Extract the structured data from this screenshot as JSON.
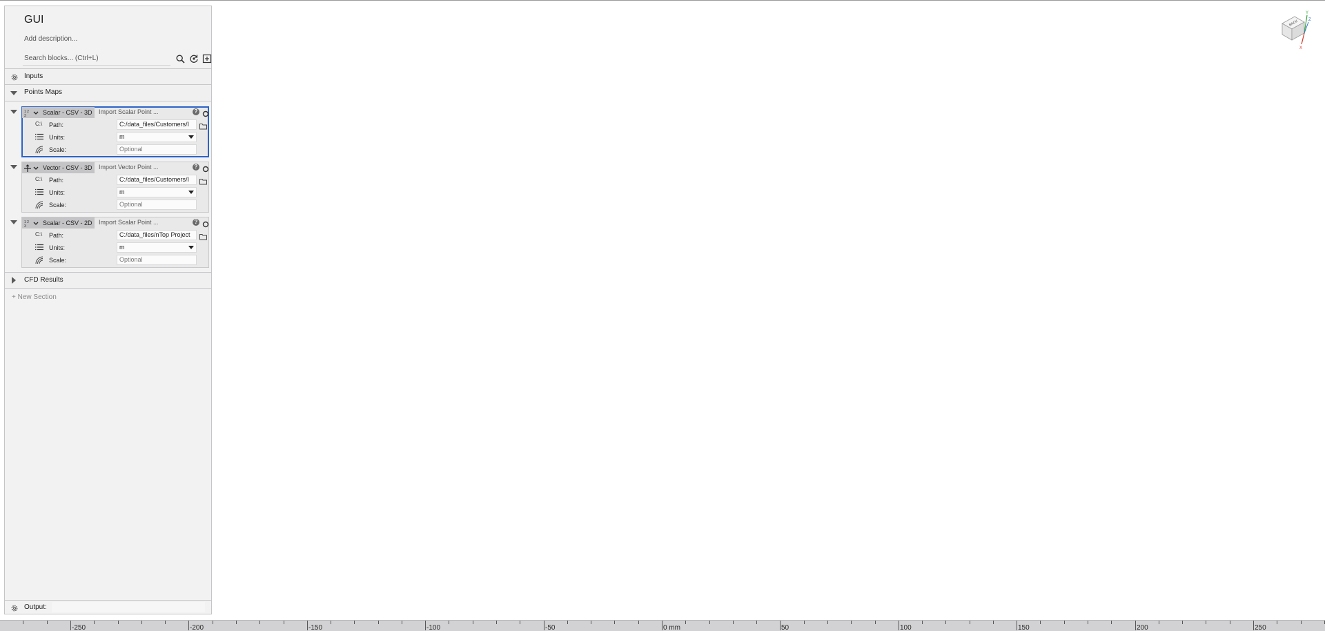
{
  "panel": {
    "title": "GUI",
    "description": "Add description...",
    "search_placeholder": "Search blocks... (Ctrl+L)"
  },
  "sections": {
    "inputs": "Inputs",
    "points_maps": "Points Maps",
    "cfd_results": "CFD Results",
    "new_section": "+ New Section"
  },
  "blocks": [
    {
      "tag": "Scalar - CSV - 3D",
      "name": "Import Scalar Point ...",
      "path_label": "Path:",
      "path_value": "C:/data_files/Customers/I",
      "units_label": "Units:",
      "units_value": "m",
      "scale_label": "Scale:",
      "scale_placeholder": "Optional"
    },
    {
      "tag": "Vector - CSV - 3D",
      "name": "Import Vector Point ...",
      "path_label": "Path:",
      "path_value": "C:/data_files/Customers/I",
      "units_label": "Units:",
      "units_value": "m",
      "scale_label": "Scale:",
      "scale_placeholder": "Optional"
    },
    {
      "tag": "Scalar - CSV - 2D",
      "name": "Import Scalar Point ...",
      "path_label": "Path:",
      "path_value": "C:/data_files/nTop Project",
      "units_label": "Units:",
      "units_value": "m",
      "scale_label": "Scale:",
      "scale_placeholder": "Optional"
    }
  ],
  "path_prefix": "C:\\",
  "output_label": "Output:",
  "ruler": {
    "labels": [
      "-250",
      "-200",
      "-150",
      "-100",
      "-50",
      "0 mm",
      "50",
      "100",
      "150",
      "200",
      "250"
    ]
  },
  "viewcube": {
    "face": "BACK",
    "axes": [
      "Y",
      "Z",
      "X"
    ]
  },
  "colors": {
    "selection": "#2b63c8",
    "axis_x": "#d23a2a",
    "axis_y": "#3aa83a"
  }
}
